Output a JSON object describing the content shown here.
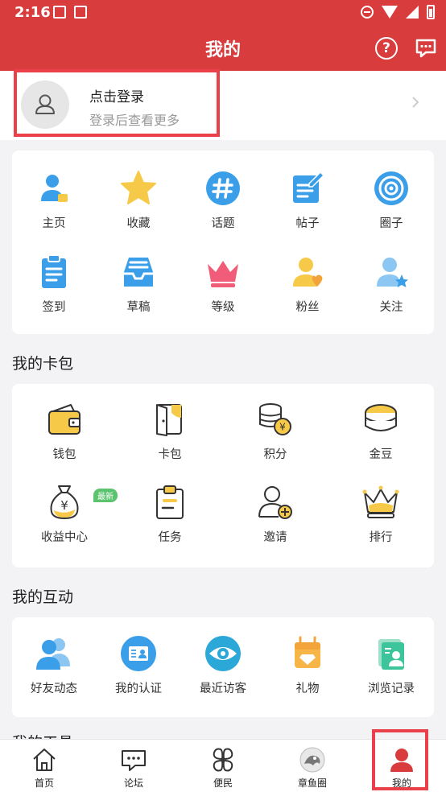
{
  "status_bar": {
    "time": "2:16"
  },
  "header": {
    "title": "我的"
  },
  "login": {
    "title": "点击登录",
    "subtitle": "登录后查看更多"
  },
  "grid1": [
    {
      "label": "主页",
      "icon": "home-user-icon"
    },
    {
      "label": "收藏",
      "icon": "star-icon"
    },
    {
      "label": "话题",
      "icon": "hashtag-icon"
    },
    {
      "label": "帖子",
      "icon": "post-edit-icon"
    },
    {
      "label": "圈子",
      "icon": "circle-target-icon"
    },
    {
      "label": "签到",
      "icon": "clipboard-icon"
    },
    {
      "label": "草稿",
      "icon": "drafts-tray-icon"
    },
    {
      "label": "等级",
      "icon": "crown-icon"
    },
    {
      "label": "粉丝",
      "icon": "fans-heart-icon"
    },
    {
      "label": "关注",
      "icon": "follow-star-icon"
    }
  ],
  "wallet_section": {
    "title": "我的卡包",
    "items": [
      {
        "label": "钱包",
        "icon": "wallet-icon"
      },
      {
        "label": "卡包",
        "icon": "card-pack-icon"
      },
      {
        "label": "积分",
        "icon": "points-coins-icon"
      },
      {
        "label": "金豆",
        "icon": "gold-beans-icon"
      },
      {
        "label": "收益中心",
        "icon": "money-bag-icon",
        "badge": "最新"
      },
      {
        "label": "任务",
        "icon": "task-clipboard-icon"
      },
      {
        "label": "邀请",
        "icon": "invite-user-icon"
      },
      {
        "label": "排行",
        "icon": "ranking-crown-icon"
      }
    ]
  },
  "interaction_section": {
    "title": "我的互动",
    "items": [
      {
        "label": "好友动态",
        "icon": "friends-icon"
      },
      {
        "label": "我的认证",
        "icon": "certification-icon"
      },
      {
        "label": "最近访客",
        "icon": "eye-icon"
      },
      {
        "label": "礼物",
        "icon": "gift-icon"
      },
      {
        "label": "浏览记录",
        "icon": "history-icon"
      }
    ]
  },
  "tools_section": {
    "title": "我的工具"
  },
  "bottom_nav": [
    {
      "label": "首页",
      "icon": "home-icon"
    },
    {
      "label": "论坛",
      "icon": "forum-icon"
    },
    {
      "label": "便民",
      "icon": "clover-icon"
    },
    {
      "label": "章鱼圈",
      "icon": "octopus-icon"
    },
    {
      "label": "我的",
      "icon": "profile-icon",
      "active": true
    }
  ],
  "colors": {
    "brand_red": "#d93c3c",
    "highlight": "#e9404a",
    "blue": "#3a9ee8",
    "yellow": "#f7c948"
  }
}
